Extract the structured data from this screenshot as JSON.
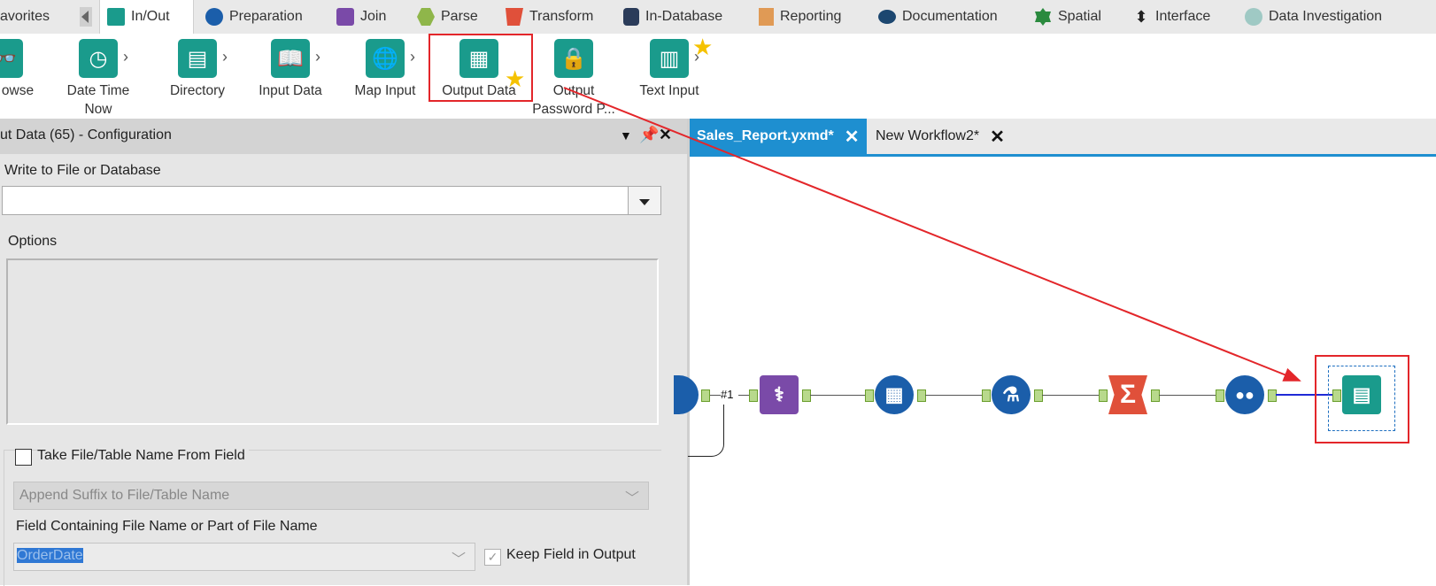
{
  "categories": {
    "favorites": "avorites",
    "in_out": "In/Out",
    "preparation": "Preparation",
    "join": "Join",
    "parse": "Parse",
    "transform": "Transform",
    "in_database": "In-Database",
    "reporting": "Reporting",
    "documentation": "Documentation",
    "spatial": "Spatial",
    "interface": "Interface",
    "data_investigation": "Data Investigation"
  },
  "tools": {
    "browse": "owse",
    "date_time_now_1": "Date Time",
    "date_time_now_2": "Now",
    "directory": "Directory",
    "input_data": "Input Data",
    "map_input": "Map Input",
    "output_data": "Output Data",
    "output_password_1": "Output",
    "output_password_2": "Password P...",
    "text_input": "Text Input"
  },
  "config": {
    "title": "ut Data (65) - Configuration",
    "write_label": "Write to File or Database",
    "write_value": "",
    "options_label": "Options",
    "take_from_field": "Take File/Table Name From Field",
    "append_mode": "Append Suffix to File/Table Name",
    "field_containing_label": "Field Containing File Name or Part of File Name",
    "field_value": "OrderDate",
    "keep_field": "Keep Field in Output"
  },
  "doc_tabs": {
    "active": "Sales_Report.yxmd*",
    "other": "New Workflow2*"
  },
  "workflow": {
    "connection_label": "#1"
  },
  "colors": {
    "accent_blue": "#1e8fd0",
    "inout_green": "#1a9b8c",
    "highlight_red": "#e3262a",
    "star_yellow": "#f5c200"
  }
}
